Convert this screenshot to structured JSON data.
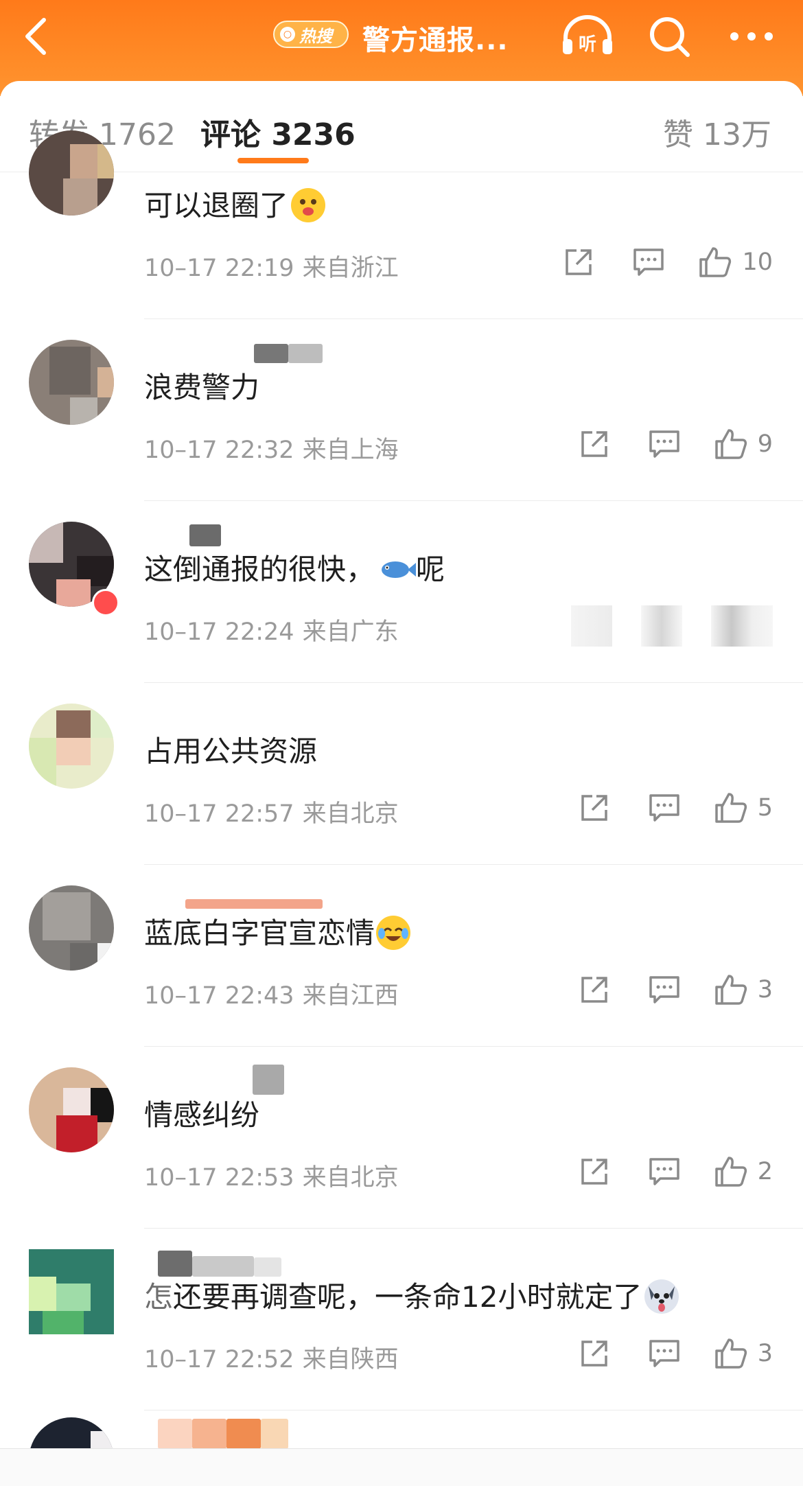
{
  "header": {
    "hot_badge_label": "热搜",
    "title": "警方通报..."
  },
  "tabs": {
    "repost": "转发 1762",
    "comment": "评论 3236",
    "like": "赞 13万"
  },
  "comments": [
    {
      "text": "可以退圈了",
      "time": "10–17 22:19",
      "location": "来自浙江",
      "likes": "10",
      "emoji": "tongue-emoji"
    },
    {
      "text": "浪费警力",
      "time": "10–17 22:32",
      "location": "来自上海",
      "likes": "9"
    },
    {
      "text_before": "这倒通报的很快，",
      "text_after": "呢",
      "time": "10–17 22:24",
      "location": "来自广东",
      "emoji": "fish-emoji"
    },
    {
      "text": "占用公共资源",
      "time": "10–17 22:57",
      "location": "来自北京",
      "likes": "5"
    },
    {
      "text": "蓝底白字官宣恋情",
      "time": "10–17 22:43",
      "location": "来自江西",
      "likes": "3",
      "emoji": "laugh-cry-emoji"
    },
    {
      "text": "情感纠纷",
      "time": "10–17 22:53",
      "location": "来自北京",
      "likes": "2"
    },
    {
      "text": "还要再调查呢，一条命12小时就定了",
      "text_prefix": "怎",
      "time": "10–17 22:52",
      "location": "来自陕西",
      "likes": "3",
      "emoji": "husky-emoji"
    }
  ],
  "colors": {
    "accent": "#ff7a1a",
    "header_bg": "#ff8a26"
  }
}
